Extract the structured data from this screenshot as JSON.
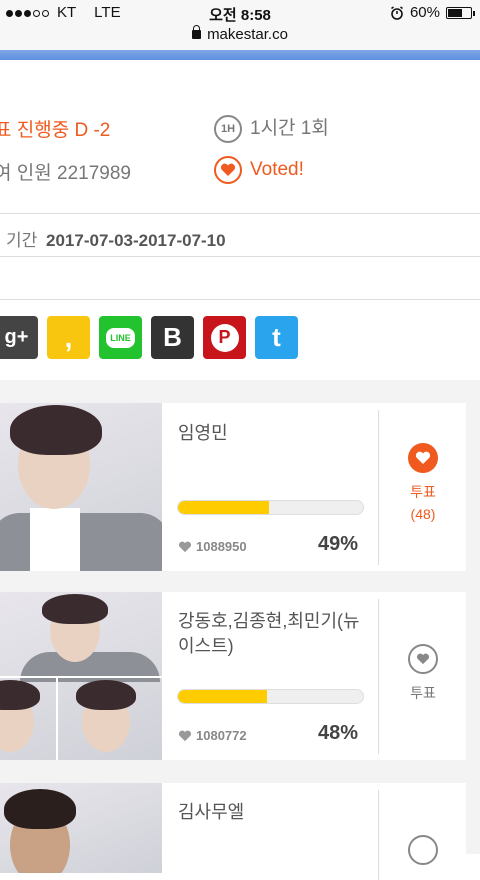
{
  "status_bar": {
    "carrier": "KT",
    "network": "LTE",
    "time": "오전 8:58",
    "battery": "60%",
    "battery_level": 0.6
  },
  "url": "makestar.co",
  "info": {
    "status_text": "표 진행중 D -2",
    "frequency_icon": "1H",
    "frequency_text": "1시간 1회",
    "participants_text": "여 인원 2217989",
    "voted_text": "Voted!",
    "period_label": "기간",
    "period_value": "2017-07-03-2017-07-10"
  },
  "share_buttons": [
    {
      "name": "google-plus",
      "label": "g+",
      "color": "#444444"
    },
    {
      "name": "kakaostory",
      "label": ",",
      "color": "#f9c60f"
    },
    {
      "name": "line",
      "label": "LINE",
      "color": "#22c32e"
    },
    {
      "name": "band",
      "label": "B",
      "color": "#333333"
    },
    {
      "name": "pinterest",
      "label": "P",
      "color": "#c8151b"
    },
    {
      "name": "twitter",
      "label": "t",
      "color": "#2aa4ed"
    }
  ],
  "candidates": [
    {
      "name": "임영민",
      "votes": "1088950",
      "percent": "49%",
      "bar": 0.49,
      "vote_label": "투표",
      "vote_count": "(48)",
      "voted": true
    },
    {
      "name": "강동호,김종현,최민기(뉴이스트)",
      "votes": "1080772",
      "percent": "48%",
      "bar": 0.48,
      "vote_label": "투표",
      "vote_count": "",
      "voted": false
    },
    {
      "name": "김사무엘",
      "votes": "",
      "percent": "",
      "bar": 0,
      "vote_label": "",
      "vote_count": "",
      "voted": false
    }
  ],
  "colors": {
    "accent": "#f05a1e",
    "bar": "#ffcc00",
    "link_bar": "#5d8fe0"
  }
}
